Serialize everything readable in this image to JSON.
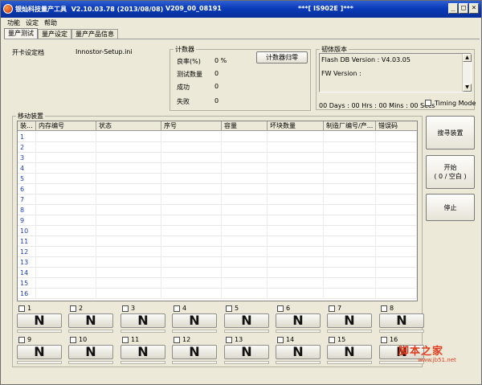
{
  "titlebar": {
    "title": "银灿科技量产工具  V2.10.03.78 (2013/08/08)",
    "version_tag": "V209_00_08191",
    "status_text": "***[ IS902E ]***",
    "buttons": [
      "_",
      "□",
      "×"
    ]
  },
  "menu": [
    "功能",
    "设定",
    "帮助"
  ],
  "tabs": [
    "量产测试",
    "量产设定",
    "量产产品信息"
  ],
  "open_card": {
    "label": "开卡设定档",
    "file": "Innostor-Setup.ini"
  },
  "counter": {
    "title": "计数器",
    "rows": [
      {
        "label": "良率(%)",
        "value": "0 %"
      },
      {
        "label": "测试数量",
        "value": "0"
      },
      {
        "label": "成功",
        "value": "0"
      },
      {
        "label": "失败",
        "value": "0"
      }
    ],
    "reset_label": "计数器归零"
  },
  "firmware": {
    "title": "韧体版本",
    "lines": [
      "Flash DB Version : V4.03.05",
      "FW Version :"
    ]
  },
  "timer": {
    "text": "00 Days : 00 Hrs : 00 Mins : 00 Secs"
  },
  "timing_mode": {
    "label": "Timing Mode"
  },
  "device_list": {
    "title": "移动装置",
    "columns": [
      "装...",
      "内存编号",
      "状态",
      "序号",
      "容量",
      "坏块数量",
      "制造厂编号/产...",
      "错误码"
    ],
    "rows": [
      "1",
      "2",
      "3",
      "4",
      "5",
      "6",
      "7",
      "8",
      "9",
      "10",
      "11",
      "12",
      "13",
      "14",
      "15",
      "16"
    ]
  },
  "actions": {
    "search": "搜寻装置",
    "start_line1": "开始",
    "start_line2": "( 0 / 空白 )",
    "stop": "停止"
  },
  "slots": [
    {
      "num": "1",
      "letter": "N"
    },
    {
      "num": "2",
      "letter": "N"
    },
    {
      "num": "3",
      "letter": "N"
    },
    {
      "num": "4",
      "letter": "N"
    },
    {
      "num": "5",
      "letter": "N"
    },
    {
      "num": "6",
      "letter": "N"
    },
    {
      "num": "7",
      "letter": "N"
    },
    {
      "num": "8",
      "letter": "N"
    },
    {
      "num": "9",
      "letter": "N"
    },
    {
      "num": "10",
      "letter": "N"
    },
    {
      "num": "11",
      "letter": "N"
    },
    {
      "num": "12",
      "letter": "N"
    },
    {
      "num": "13",
      "letter": "N"
    },
    {
      "num": "14",
      "letter": "N"
    },
    {
      "num": "15",
      "letter": "N"
    },
    {
      "num": "16",
      "letter": "N"
    }
  ],
  "watermark": {
    "text": "脚本之家",
    "url": "www.jb51.net"
  }
}
